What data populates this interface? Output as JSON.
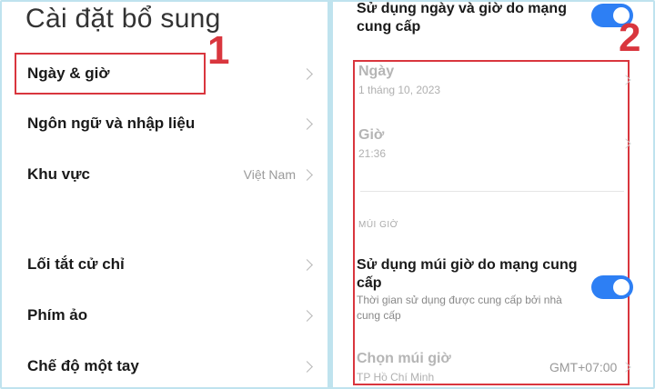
{
  "left": {
    "title": "Cài đặt bổ sung",
    "items": [
      {
        "label": "Ngày & giờ",
        "value": ""
      },
      {
        "label": "Ngôn ngữ và nhập liệu",
        "value": ""
      },
      {
        "label": "Khu vực",
        "value": "Việt Nam"
      },
      {
        "label": "Lối tắt cử chỉ",
        "value": ""
      },
      {
        "label": "Phím ảo",
        "value": ""
      },
      {
        "label": "Chế độ một tay",
        "value": ""
      }
    ],
    "step_number": "1"
  },
  "right": {
    "network_time": {
      "label_line1": "Sử dụng ngày và giờ do mạng",
      "label_line2": "cung cấp",
      "enabled": true
    },
    "date": {
      "label": "Ngày",
      "value": "1 tháng 10, 2023"
    },
    "time": {
      "label": "Giờ",
      "value": "21:36"
    },
    "section_header": "MÚI GIỜ",
    "network_timezone": {
      "label_line1": "Sử dụng múi giờ do mạng cung",
      "label_line2": "cấp",
      "desc_line1": "Thời gian sử dụng được cung cấp bởi nhà",
      "desc_line2": "cung cấp",
      "enabled": true
    },
    "choose_timezone": {
      "label": "Chọn múi giờ",
      "sub": "TP Hồ Chí Minh",
      "value": "GMT+07:00"
    },
    "step_number": "2"
  },
  "colors": {
    "accent": "#2d7ff4",
    "highlight": "#d9363e",
    "frame": "#bfe3ee"
  }
}
